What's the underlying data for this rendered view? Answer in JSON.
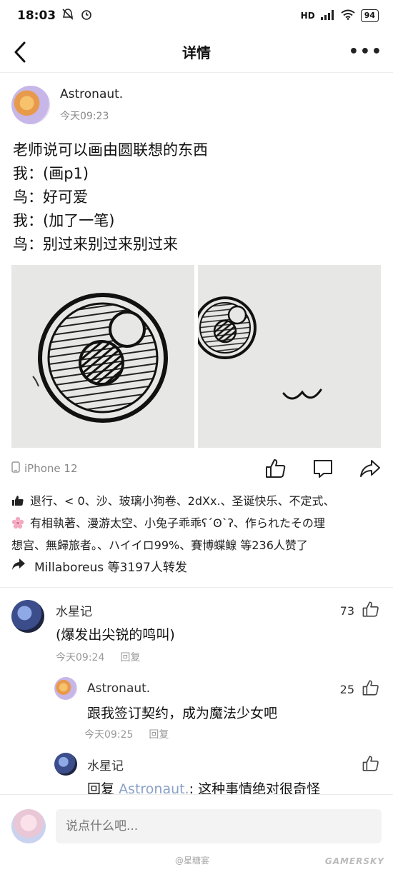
{
  "status_bar": {
    "time": "18:03",
    "network": "HD",
    "battery": "94"
  },
  "nav": {
    "title": "详情"
  },
  "post": {
    "author": "Astronaut.",
    "time": "今天09:23",
    "lines": [
      "老师说可以画由圆联想的东西",
      "我：(画p1)",
      "鸟：好可爱",
      "我：(加了一笔)",
      "鸟：别过来别过来别过来"
    ],
    "device": "iPhone 12"
  },
  "likes": {
    "line1": "退行、< 0、沙、玻璃小狗卷、2dXx.、圣诞快乐、不定式、",
    "line2": "有相執著、漫游太空、小兔子乖乖ʕ´ʘ`ʔ、作られたその理",
    "line3": "想宫、無歸旅者。、ハイイロ99%、賽博蝶鳈 等236人赞了"
  },
  "forwards": {
    "text": "Millaboreus 等3197人转发"
  },
  "comments": [
    {
      "name": "水星记",
      "text": "(爆发出尖锐的鸣叫)",
      "time": "今天09:24",
      "reply_label": "回复",
      "likes": "73"
    },
    {
      "name": "Astronaut.",
      "text": "跟我签订契约，成为魔法少女吧",
      "time": "今天09:25",
      "reply_label": "回复",
      "likes": "25"
    },
    {
      "name": "水星记",
      "reply_prefix": "回复",
      "reply_target": "Astronaut.",
      "text": ": 这种事情绝对很奇怪"
    }
  ],
  "input": {
    "placeholder": "说点什么吧..."
  },
  "watermark": {
    "weibo": "@星糖宴",
    "site": "GAMERSKY"
  }
}
